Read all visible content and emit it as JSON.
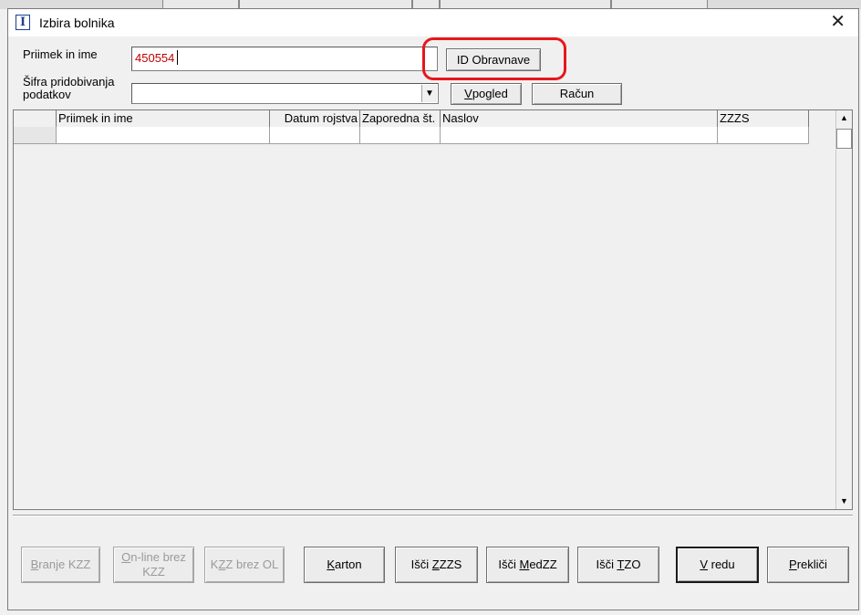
{
  "window": {
    "title": "Izbira bolnika",
    "close_icon": "close-icon"
  },
  "form": {
    "name_label": "Priimek in ime",
    "name_value": "450554",
    "source_label_line1": "Šifra pridobivanja",
    "source_label_line2": "podatkov",
    "source_value": ""
  },
  "buttons": {
    "id_obravnave": "ID Obravnave",
    "vpogled": "Vpogled",
    "racun": "Račun"
  },
  "grid": {
    "columns": [
      "",
      "Priimek in ime",
      "Datum rojstva",
      "Zaporedna št.",
      "Naslov",
      "ZZZS",
      ""
    ],
    "rows": [
      [
        "",
        "",
        "",
        "",
        "",
        "",
        ""
      ]
    ]
  },
  "bottom_buttons": [
    {
      "label": "Branje KZZ",
      "enabled": false
    },
    {
      "label": "On-line brez KZZ",
      "enabled": false
    },
    {
      "label": "KZZ brez OL",
      "enabled": false
    },
    {
      "label": "Karton",
      "enabled": true
    },
    {
      "label": "Išči ZZZS",
      "enabled": true
    },
    {
      "label": "Išči MedZZ",
      "enabled": true
    },
    {
      "label": "Išči TZO",
      "enabled": true
    },
    {
      "label": "V redu",
      "enabled": true
    },
    {
      "label": "Prekliči",
      "enabled": true
    }
  ],
  "colors": {
    "highlight": "#e8161b",
    "input_text": "#c00000"
  }
}
